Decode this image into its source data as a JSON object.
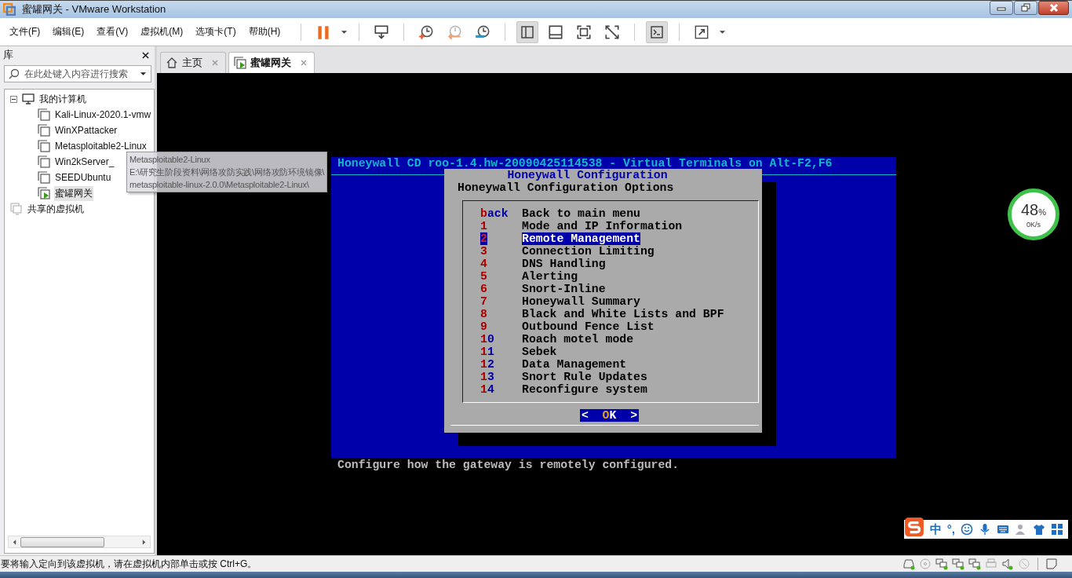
{
  "window": {
    "title": "蜜罐网关 - VMware Workstation"
  },
  "menu": [
    "文件(F)",
    "编辑(E)",
    "查看(V)",
    "虚拟机(M)",
    "选项卡(T)",
    "帮助(H)"
  ],
  "library": {
    "title": "库",
    "search": {
      "placeholder": "在此处键入内容进行搜索"
    },
    "tree": [
      {
        "label": "我的计算机",
        "kind": "computer",
        "expanded": true,
        "children": [
          {
            "label": "Kali-Linux-2020.1-vmw",
            "kind": "vm",
            "running": false,
            "selected": false
          },
          {
            "label": "WinXPattacker",
            "kind": "vm",
            "running": false,
            "selected": false
          },
          {
            "label": "Metasploitable2-Linux",
            "kind": "vm",
            "running": false,
            "selected": false
          },
          {
            "label": "Win2kServer_",
            "kind": "vm",
            "running": false,
            "selected": false
          },
          {
            "label": "SEEDUbuntu",
            "kind": "vm",
            "running": false,
            "selected": false
          },
          {
            "label": "蜜罐网关",
            "kind": "vm",
            "running": true,
            "selected": true
          }
        ]
      },
      {
        "label": "共享的虚拟机",
        "kind": "shared"
      }
    ],
    "tooltip": [
      "Metasploitable2-Linux",
      "E:\\研究生阶段资料\\网络攻防实践\\网络攻防环境镜像\\",
      "metasploitable-linux-2.0.0\\Metasploitable2-Linux\\"
    ]
  },
  "tabs": [
    {
      "label": "主页",
      "kind": "home",
      "selected": false
    },
    {
      "label": "蜜罐网关",
      "kind": "vm",
      "selected": true
    }
  ],
  "terminal": {
    "header": "Honeywall CD roo-1.4.hw-20090425114538 - Virtual Terminals on Alt-F2,F6",
    "dialog": {
      "title": "Honeywall Configuration",
      "subtitle": "Honeywall Configuration Options",
      "items": [
        {
          "key": "back",
          "label": "Back to main menu",
          "selected": false
        },
        {
          "key": "1",
          "label": "Mode and IP Information",
          "selected": false
        },
        {
          "key": "2",
          "label": "Remote Management",
          "selected": true
        },
        {
          "key": "3",
          "label": "Connection Limiting",
          "selected": false
        },
        {
          "key": "4",
          "label": "DNS Handling",
          "selected": false
        },
        {
          "key": "5",
          "label": "Alerting",
          "selected": false
        },
        {
          "key": "6",
          "label": "Snort-Inline",
          "selected": false
        },
        {
          "key": "7",
          "label": "Honeywall Summary",
          "selected": false
        },
        {
          "key": "8",
          "label": "Black and White Lists and BPF",
          "selected": false
        },
        {
          "key": "9",
          "label": "Outbound Fence List",
          "selected": false
        },
        {
          "key": "10",
          "label": "Roach motel mode",
          "selected": false
        },
        {
          "key": "11",
          "label": "Sebek",
          "selected": false
        },
        {
          "key": "12",
          "label": "Data Management",
          "selected": false
        },
        {
          "key": "13",
          "label": "Snort Rule Updates",
          "selected": false
        },
        {
          "key": "14",
          "label": "Reconfigure system",
          "selected": false
        }
      ],
      "ok": {
        "left": "<",
        "label": "OK",
        "right": ">"
      }
    },
    "status": "Configure how the gateway is remotely configured."
  },
  "net_widget": {
    "percent": "48",
    "unit": "%",
    "speed": "0K/s"
  },
  "ime": {
    "mode": "中",
    "punct": "°,"
  },
  "status_bar": {
    "message": "要将输入定向到该虚拟机，请在虚拟机内部单击或按 Ctrl+G。"
  }
}
